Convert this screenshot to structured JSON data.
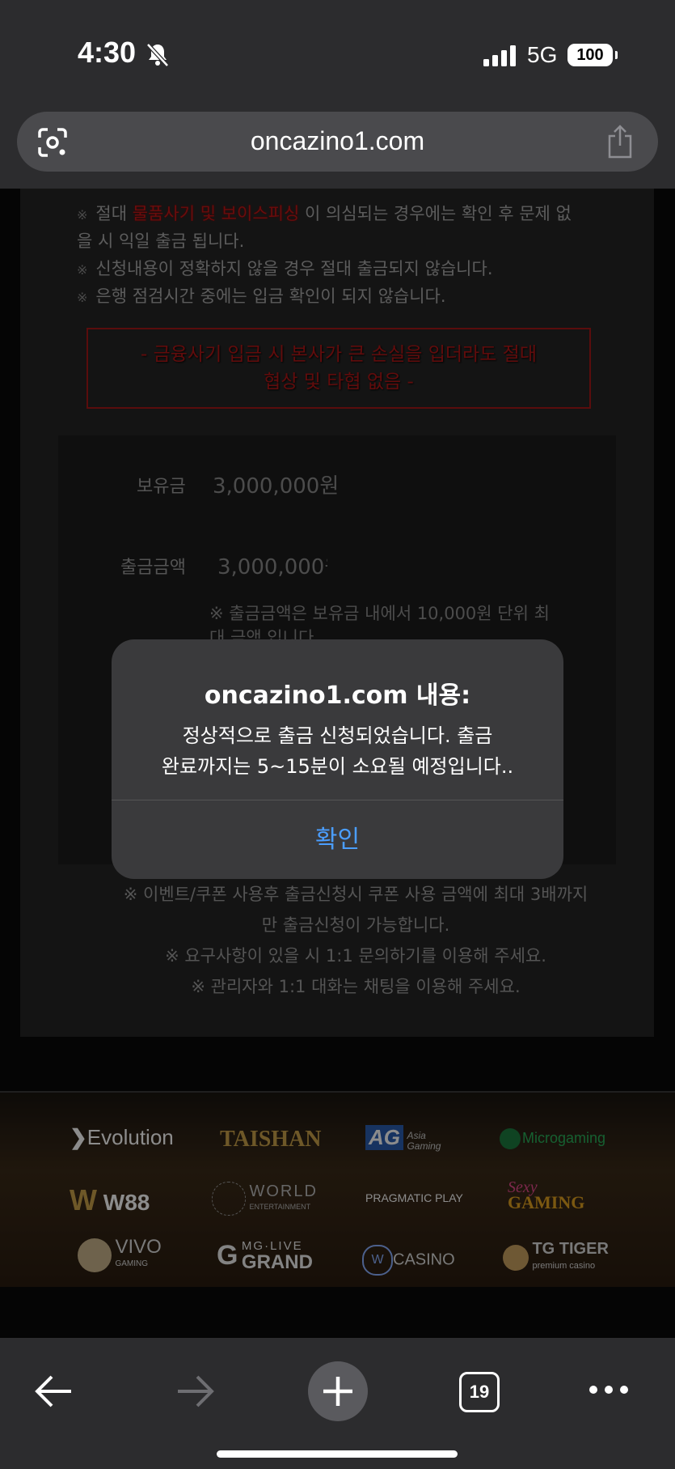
{
  "status": {
    "time": "4:30",
    "network": "5G",
    "battery": "100"
  },
  "browser": {
    "url": "oncazino1.com",
    "tab_count": "19"
  },
  "notices": {
    "line1_pre": "절대",
    "line1_red": "물품사기 및 보이스피싱",
    "line1_post": "이 의심되는 경우에는 확인 후 문제 없",
    "line1_cont": "을 시 익일 출금 됩니다.",
    "line2": "신청내용이 정확하지 않을 경우 절대 출금되지 않습니다.",
    "line3": "은행 점검시간 중에는 입금 확인이 되지 않습니다.",
    "mark": "※"
  },
  "warning": {
    "line1": "- 금융사기 입금 시 본사가 큰 손실을 입더라도 절대",
    "line2": "협상 및 타협 없음 -"
  },
  "form": {
    "balance_label": "보유금",
    "balance_value": "3,000,000원",
    "withdraw_label": "출금금액",
    "withdraw_value": "3,000,000원",
    "hint_line1": "※ 출금금액은 보유금 내에서 10,000원 단위 최",
    "hint_line2": "대 금액 입니다."
  },
  "bottom_notes": {
    "line1": "※ 이벤트/쿠폰 사용후 출금신청시 쿠폰 사용 금액에 최대 3배까지",
    "line2": "만 출금신청이 가능합니다.",
    "line3": "※ 요구사항이 있을 시 1:1 문의하기를 이용해 주세요.",
    "line4": "※ 관리자와 1:1 대화는 채팅을 이용해 주세요."
  },
  "providers": {
    "evolution": "Evolution",
    "taishan": "TAISHAN",
    "ag": "AG",
    "ag_sub1": "Asia",
    "ag_sub2": "Gaming",
    "microgaming": "Microgaming",
    "w88": "W88",
    "world1": "WORLD",
    "world2": "ENTERTAINMENT",
    "pragmatic": "PRAGMATIC PLAY",
    "sexy1": "Sexy",
    "sexy2": "GAMING",
    "vivo1": "VIVO",
    "vivo2": "GAMING",
    "mg1": "MG·LIVE",
    "mg2": "GRAND",
    "wm": "CASINO",
    "tg1": "TG TIGER",
    "tg2": "premium casino"
  },
  "dialog": {
    "title": "oncazino1.com 내용:",
    "line1": "정상적으로 출금 신청되었습니다. 출금",
    "line2": "완료까지는 5~15분이 소요될 예정입니다..",
    "confirm": "확인"
  }
}
